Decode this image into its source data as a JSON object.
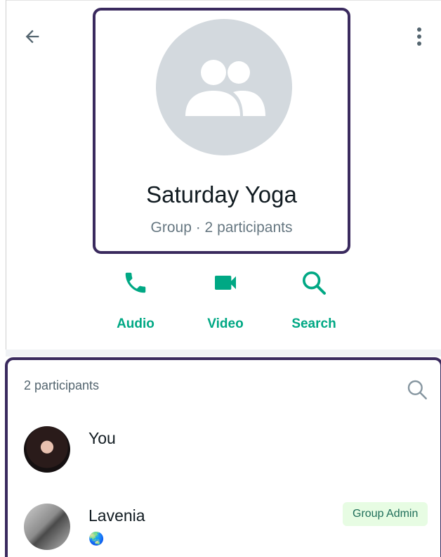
{
  "header": {
    "group_name": "Saturday Yoga",
    "group_subtitle": "Group · 2 participants"
  },
  "actions": [
    {
      "label": "Audio",
      "icon": "phone-icon"
    },
    {
      "label": "Video",
      "icon": "video-camera-icon"
    },
    {
      "label": "Search",
      "icon": "search-icon"
    }
  ],
  "participants": {
    "count_label": "2 participants",
    "items": [
      {
        "name": "You",
        "status": "",
        "badge": ""
      },
      {
        "name": "Lavenia",
        "status": "🌏",
        "badge": "Group Admin"
      }
    ]
  },
  "colors": {
    "accent": "#00a884",
    "highlight_border": "#3a2a5e",
    "avatar_placeholder": "#d3d9de",
    "admin_badge_bg": "#e7fce3"
  }
}
